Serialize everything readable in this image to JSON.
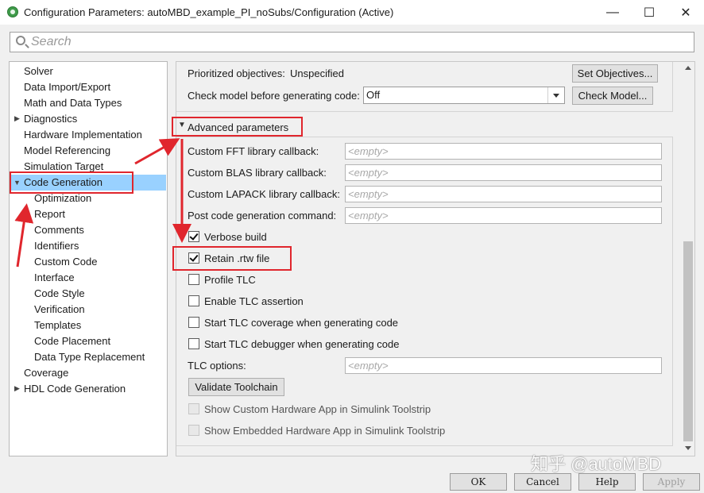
{
  "window": {
    "title": "Configuration Parameters: autoMBD_example_PI_noSubs/Configuration (Active)",
    "minimize_glyph": "—",
    "maximize_glyph": "☐",
    "close_glyph": "✕",
    "app_icon": "simulink-gear-icon"
  },
  "search": {
    "placeholder": "Search"
  },
  "tree": {
    "items": [
      {
        "label": "Solver",
        "level": 0,
        "arrow": ""
      },
      {
        "label": "Data Import/Export",
        "level": 0,
        "arrow": ""
      },
      {
        "label": "Math and Data Types",
        "level": 0,
        "arrow": ""
      },
      {
        "label": "Diagnostics",
        "level": 0,
        "arrow": "▶"
      },
      {
        "label": "Hardware Implementation",
        "level": 0,
        "arrow": ""
      },
      {
        "label": "Model Referencing",
        "level": 0,
        "arrow": ""
      },
      {
        "label": "Simulation Target",
        "level": 0,
        "arrow": ""
      },
      {
        "label": "Code Generation",
        "level": 0,
        "arrow": "▼",
        "selected": true
      },
      {
        "label": "Optimization",
        "level": 1,
        "arrow": ""
      },
      {
        "label": "Report",
        "level": 1,
        "arrow": ""
      },
      {
        "label": "Comments",
        "level": 1,
        "arrow": ""
      },
      {
        "label": "Identifiers",
        "level": 1,
        "arrow": ""
      },
      {
        "label": "Custom Code",
        "level": 1,
        "arrow": ""
      },
      {
        "label": "Interface",
        "level": 1,
        "arrow": ""
      },
      {
        "label": "Code Style",
        "level": 1,
        "arrow": ""
      },
      {
        "label": "Verification",
        "level": 1,
        "arrow": ""
      },
      {
        "label": "Templates",
        "level": 1,
        "arrow": ""
      },
      {
        "label": "Code Placement",
        "level": 1,
        "arrow": ""
      },
      {
        "label": "Data Type Replacement",
        "level": 1,
        "arrow": ""
      },
      {
        "label": "Coverage",
        "level": 0,
        "arrow": ""
      },
      {
        "label": "HDL Code Generation",
        "level": 0,
        "arrow": "▶"
      }
    ]
  },
  "panel": {
    "prioritized_label": "Prioritized objectives:",
    "prioritized_value": "Unspecified",
    "set_objectives_button": "Set Objectives...",
    "check_model_label": "Check model before generating code:",
    "check_model_value": "Off",
    "check_model_button": "Check Model...",
    "advanced_arrow": "▼",
    "advanced_label": "Advanced parameters",
    "fields": [
      {
        "label": "Custom FFT library callback:",
        "value": "<empty>"
      },
      {
        "label": "Custom BLAS library callback:",
        "value": "<empty>"
      },
      {
        "label": "Custom LAPACK library callback:",
        "value": "<empty>"
      },
      {
        "label": "Post code generation command:",
        "value": "<empty>"
      }
    ],
    "checkboxes": [
      {
        "label": "Verbose build",
        "checked": true,
        "disabled": false
      },
      {
        "label": "Retain .rtw file",
        "checked": true,
        "disabled": false
      },
      {
        "label": "Profile TLC",
        "checked": false,
        "disabled": false
      },
      {
        "label": "Enable TLC assertion",
        "checked": false,
        "disabled": false
      },
      {
        "label": "Start TLC coverage when generating code",
        "checked": false,
        "disabled": false
      },
      {
        "label": "Start TLC debugger when generating code",
        "checked": false,
        "disabled": false
      }
    ],
    "tlc_options_label": "TLC options:",
    "tlc_options_value": "<empty>",
    "validate_button": "Validate Toolchain",
    "disabled_checkboxes": [
      {
        "label": "Show Custom Hardware App in Simulink Toolstrip",
        "checked": false,
        "disabled": true
      },
      {
        "label": "Show Embedded Hardware App in Simulink Toolstrip",
        "checked": false,
        "disabled": true
      }
    ]
  },
  "footer": {
    "ok": "OK",
    "cancel": "Cancel",
    "help": "Help",
    "apply": "Apply",
    "apply_enabled": false
  },
  "watermark": "知乎 @autoMBD",
  "colors": {
    "annotation_red": "#e0262d",
    "tree_selection": "#99d1ff"
  }
}
